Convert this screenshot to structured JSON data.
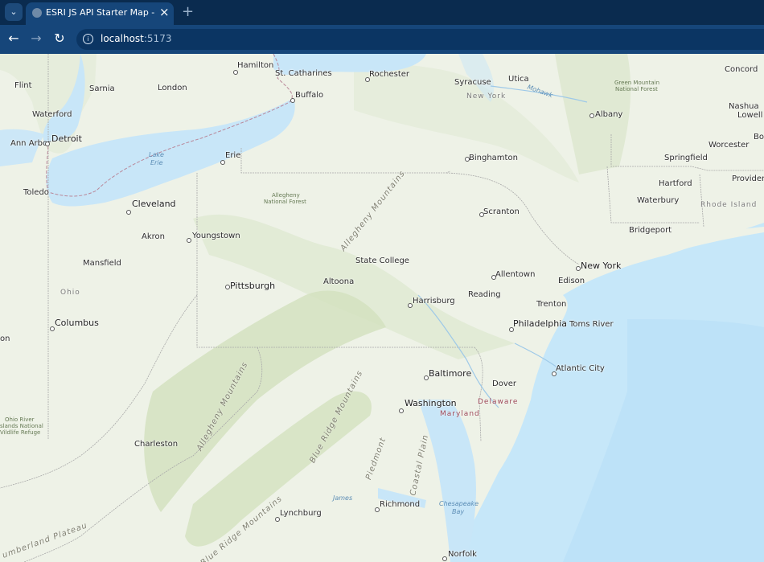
{
  "browser": {
    "tab_title": "ESRI JS API Starter Map - React",
    "url_host": "localhost",
    "url_port": ":5173",
    "tab_close": "×",
    "new_tab": "+",
    "tab_menu": "⌄",
    "back": "←",
    "forward": "→",
    "reload": "↻",
    "info": "i"
  },
  "map": {
    "cities": [
      {
        "id": "hamilton",
        "name": "Hamilton"
      },
      {
        "id": "st-catharines",
        "name": "St. Catharines"
      },
      {
        "id": "rochester",
        "name": "Rochester"
      },
      {
        "id": "syracuse",
        "name": "Syracuse"
      },
      {
        "id": "utica",
        "name": "Utica"
      },
      {
        "id": "concord",
        "name": "Concord"
      },
      {
        "id": "flint",
        "name": "Flint"
      },
      {
        "id": "sarnia",
        "name": "Sarnia"
      },
      {
        "id": "london",
        "name": "London"
      },
      {
        "id": "buffalo",
        "name": "Buffalo"
      },
      {
        "id": "nashua",
        "name": "Nashua"
      },
      {
        "id": "lowell",
        "name": "Lowell"
      },
      {
        "id": "waterford",
        "name": "Waterford"
      },
      {
        "id": "albany",
        "name": "Albany"
      },
      {
        "id": "bos",
        "name": "Bos"
      },
      {
        "id": "ann-arbor",
        "name": "Ann Arbor"
      },
      {
        "id": "detroit",
        "name": "Detroit"
      },
      {
        "id": "worcester",
        "name": "Worcester"
      },
      {
        "id": "erie",
        "name": "Erie"
      },
      {
        "id": "binghamton",
        "name": "Binghamton"
      },
      {
        "id": "springfield",
        "name": "Springfield"
      },
      {
        "id": "providence",
        "name": "Providen"
      },
      {
        "id": "toledo",
        "name": "Toledo"
      },
      {
        "id": "hartford",
        "name": "Hartford"
      },
      {
        "id": "cleveland",
        "name": "Cleveland"
      },
      {
        "id": "waterbury",
        "name": "Waterbury"
      },
      {
        "id": "scranton",
        "name": "Scranton"
      },
      {
        "id": "akron",
        "name": "Akron"
      },
      {
        "id": "youngstown",
        "name": "Youngstown"
      },
      {
        "id": "bridgeport",
        "name": "Bridgeport"
      },
      {
        "id": "mansfield",
        "name": "Mansfield"
      },
      {
        "id": "state-college",
        "name": "State College"
      },
      {
        "id": "new-york",
        "name": "New York"
      },
      {
        "id": "allentown",
        "name": "Allentown"
      },
      {
        "id": "pittsburgh",
        "name": "Pittsburgh"
      },
      {
        "id": "altoona",
        "name": "Altoona"
      },
      {
        "id": "edison",
        "name": "Edison"
      },
      {
        "id": "reading",
        "name": "Reading"
      },
      {
        "id": "harrisburg",
        "name": "Harrisburg"
      },
      {
        "id": "trenton",
        "name": "Trenton"
      },
      {
        "id": "columbus",
        "name": "Columbus"
      },
      {
        "id": "philadelphia",
        "name": "Philadelphia"
      },
      {
        "id": "toms-river",
        "name": "Toms River"
      },
      {
        "id": "on",
        "name": "on"
      },
      {
        "id": "atlantic-city",
        "name": "Atlantic City"
      },
      {
        "id": "baltimore",
        "name": "Baltimore"
      },
      {
        "id": "dover",
        "name": "Dover"
      },
      {
        "id": "washington",
        "name": "Washington"
      },
      {
        "id": "charleston",
        "name": "Charleston"
      },
      {
        "id": "richmond",
        "name": "Richmond"
      },
      {
        "id": "lynchburg",
        "name": "Lynchburg"
      },
      {
        "id": "norfolk",
        "name": "Norfolk"
      }
    ],
    "states": {
      "new_york": "New York",
      "ohio": "Ohio",
      "rhode_island": "Rhode Island",
      "delaware": "Delaware",
      "maryland": "Maryland"
    },
    "water": {
      "lake_erie_1": "Lake",
      "lake_erie_2": "Erie",
      "mohawk": "Mohawk",
      "james": "James",
      "chesapeake_1": "Chesapeake",
      "chesapeake_2": "Bay"
    },
    "parks": {
      "green_mountain_1": "Green Mountain",
      "green_mountain_2": "National Forest",
      "allegheny_nf_1": "Allegheny",
      "allegheny_nf_2": "National Forest",
      "ohio_river_1": "Ohio River",
      "ohio_river_2": "slands National",
      "ohio_river_3": "Vildlife Refuge"
    },
    "mountains": {
      "allegheny_1": "Allegheny Mountains",
      "allegheny_2": "Allegheny Mountains",
      "blue_ridge_1": "Blue Ridge Mountains",
      "blue_ridge_2": "Blue Ridge Mountains",
      "piedmont": "Piedmont",
      "coastal_plain": "Coastal Plain",
      "cumberland": "umberland Plateau"
    },
    "colors": {
      "land": "#eef2e7",
      "water": "#c8e6f8",
      "ocean": "#bfe4f9",
      "relief": "#d5e2c3",
      "border": "#a9a9a9",
      "intl_border": "#b9889a"
    }
  }
}
